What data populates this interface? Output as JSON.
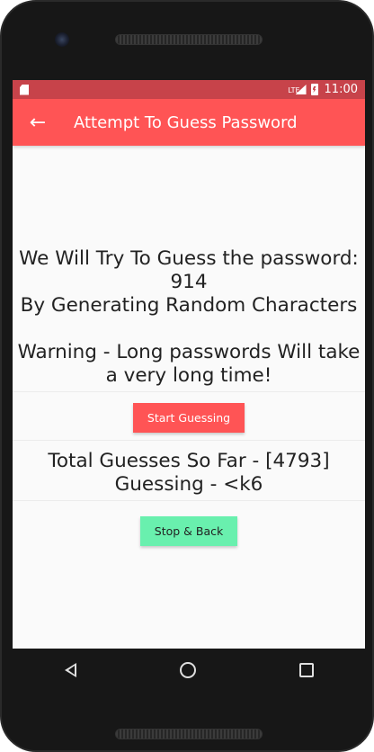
{
  "status_bar": {
    "network": "LTE",
    "time": "11:00"
  },
  "app_bar": {
    "title": "Attempt To Guess Password",
    "back_icon": "arrow-left-icon"
  },
  "message": {
    "line1": "We Will Try To Guess the password:",
    "password": "914",
    "line3": "By Generating Random Characters",
    "warning_line1": "Warning - Long passwords Will take",
    "warning_line2": "a very long time!"
  },
  "buttons": {
    "start_label": "Start Guessing",
    "stop_label": "Stop & Back"
  },
  "progress": {
    "total_guesses": "Total Guesses So Far - [4793]",
    "current_guess": "Guessing - <k6"
  },
  "colors": {
    "primary": "#ff5455",
    "status_bar": "#c7434a",
    "accent": "#69f0ae"
  }
}
